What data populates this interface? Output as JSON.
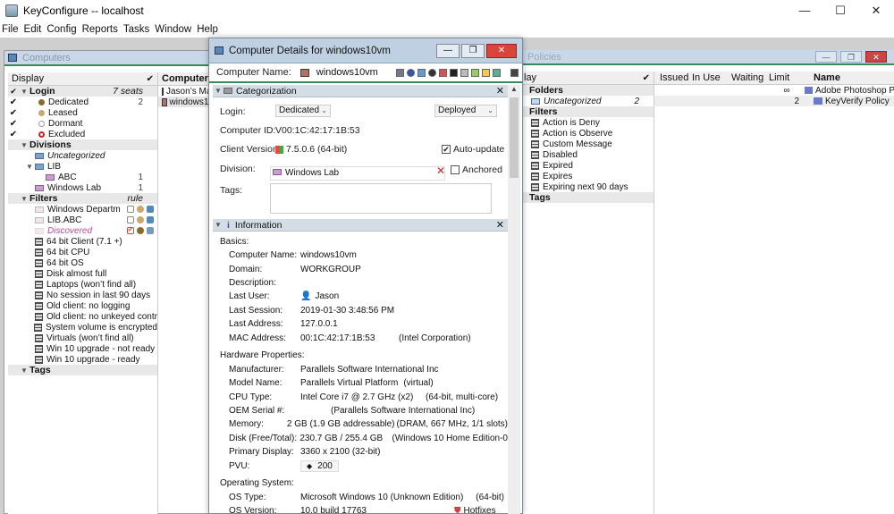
{
  "app": {
    "title": "KeyConfigure -- localhost"
  },
  "window_controls": {
    "minimize": "—",
    "maximize": "☐",
    "close": "✕"
  },
  "menu": [
    "File",
    "Edit",
    "Config",
    "Reports",
    "Tasks",
    "Window",
    "Help"
  ],
  "computers_window": {
    "title": "Computers",
    "display_header": "Display",
    "computer_header": "Computer",
    "computer_list": [
      "Jason’s Mac",
      "windows10"
    ],
    "login": {
      "label": "Login",
      "seats": "7 seats",
      "items": [
        {
          "label": "Dedicated",
          "count": "2",
          "color": "#8a6a2a"
        },
        {
          "label": "Leased",
          "count": "",
          "color": "#c9a86a"
        },
        {
          "label": "Dormant",
          "count": "",
          "color": "#ffffff"
        },
        {
          "label": "Excluded",
          "count": "",
          "color": "#c22"
        }
      ]
    },
    "divisions": {
      "label": "Divisions",
      "items": [
        {
          "label": "Uncategorized",
          "count": ""
        },
        {
          "label": "LIB",
          "count": ""
        },
        {
          "label": "ABC",
          "count": "1"
        },
        {
          "label": "Windows Lab",
          "count": "1"
        }
      ]
    },
    "filters": {
      "label": "Filters",
      "rule": "rule",
      "named": [
        "Windows Departm",
        "LIB.ABC",
        "Discovered"
      ],
      "items": [
        "64 bit Client (7.1 +)",
        "64 bit CPU",
        "64 bit OS",
        "Disk almost full",
        "Laptops (won’t find all)",
        "No session in last 90 days",
        "Old client: no logging",
        "Old client: no unkeyed contr",
        "System volume is encrypted",
        "Virtuals (won’t find all)",
        "Win 10 upgrade - not ready",
        "Win 10 upgrade - ready"
      ]
    },
    "tags": {
      "label": "Tags"
    }
  },
  "policies_window": {
    "title": "Policies",
    "display_header": "lay",
    "folders": {
      "label": "Folders",
      "items": [
        {
          "label": "Uncategorized",
          "count": "2"
        }
      ]
    },
    "filters": {
      "label": "Filters",
      "items": [
        "Action is Deny",
        "Action is Observe",
        "Custom Message",
        "Disabled",
        "Expired",
        "Expires",
        "Expiring next 90 days"
      ]
    },
    "tags": {
      "label": "Tags"
    },
    "columns": [
      "Issued",
      "In Use",
      "Waiting",
      "Limit",
      "Name"
    ],
    "rows": [
      {
        "limit": "∞",
        "name": "Adobe Photoshop P"
      },
      {
        "limit": "2",
        "name": "KeyVerify Policy"
      }
    ]
  },
  "details_window": {
    "title": "Computer Details for windows10vm",
    "computer_name_label": "Computer Name:",
    "computer_name": "windows10vm",
    "categorization": {
      "label": "Categorization",
      "login_label": "Login:",
      "login_value": "Dedicated",
      "deploy_value": "Deployed",
      "computer_id_label": "Computer ID:",
      "computer_id": "V00:1C:42:17:1B:53",
      "client_version_label": "Client Version:",
      "client_version": "7.5.0.6 (64-bit)",
      "auto_update_label": "Auto-update",
      "division_label": "Division:",
      "division_value": "Windows Lab",
      "anchored_label": "Anchored",
      "tags_label": "Tags:"
    },
    "information": {
      "label": "Information",
      "basics_label": "Basics:",
      "basics": [
        {
          "k": "Computer Name:",
          "v": "windows10vm",
          "extra": ""
        },
        {
          "k": "Domain:",
          "v": "WORKGROUP",
          "extra": ""
        },
        {
          "k": "Description:",
          "v": "",
          "extra": ""
        },
        {
          "k": "Last User:",
          "v": "Jason",
          "extra": ""
        },
        {
          "k": "Last Session:",
          "v": "2019-01-30  3:48:56 PM",
          "extra": ""
        },
        {
          "k": "Last Address:",
          "v": "127.0.0.1",
          "extra": ""
        },
        {
          "k": "MAC Address:",
          "v": "00:1C:42:17:1B:53",
          "extra": "(Intel Corporation)"
        }
      ],
      "hardware_label": "Hardware Properties:",
      "hardware": [
        {
          "k": "Manufacturer:",
          "v": "Parallels Software International Inc",
          "extra": ""
        },
        {
          "k": "Model Name:",
          "v": "Parallels Virtual Platform",
          "extra": "(virtual)"
        },
        {
          "k": "CPU Type:",
          "v": "Intel Core i7 @ 2.7 GHz (x2)",
          "extra": "(64-bit, multi-core)"
        },
        {
          "k": "OEM Serial #:",
          "v": "",
          "extra": "(Parallels Software International Inc)"
        },
        {
          "k": "Memory:",
          "v": "2 GB (1.9 GB addressable)",
          "extra": "(DRAM, 667 MHz, 1/1 slots)"
        },
        {
          "k": "Disk (Free/Total):",
          "v": "230.7 GB / 255.4 GB",
          "extra": "(Windows 10 Home Edition-0"
        },
        {
          "k": "Primary Display:",
          "v": "3360 x 2100 (32-bit)",
          "extra": ""
        },
        {
          "k": "PVU:",
          "v": "200",
          "extra": ""
        }
      ],
      "os_label": "Operating System:",
      "os": [
        {
          "k": "OS Type:",
          "v": "Microsoft Windows 10 (Unknown Edition)",
          "extra": "(64-bit)"
        },
        {
          "k": "OS Version:",
          "v": "10.0 build 17763",
          "extra": "Hotfixes"
        }
      ]
    }
  }
}
